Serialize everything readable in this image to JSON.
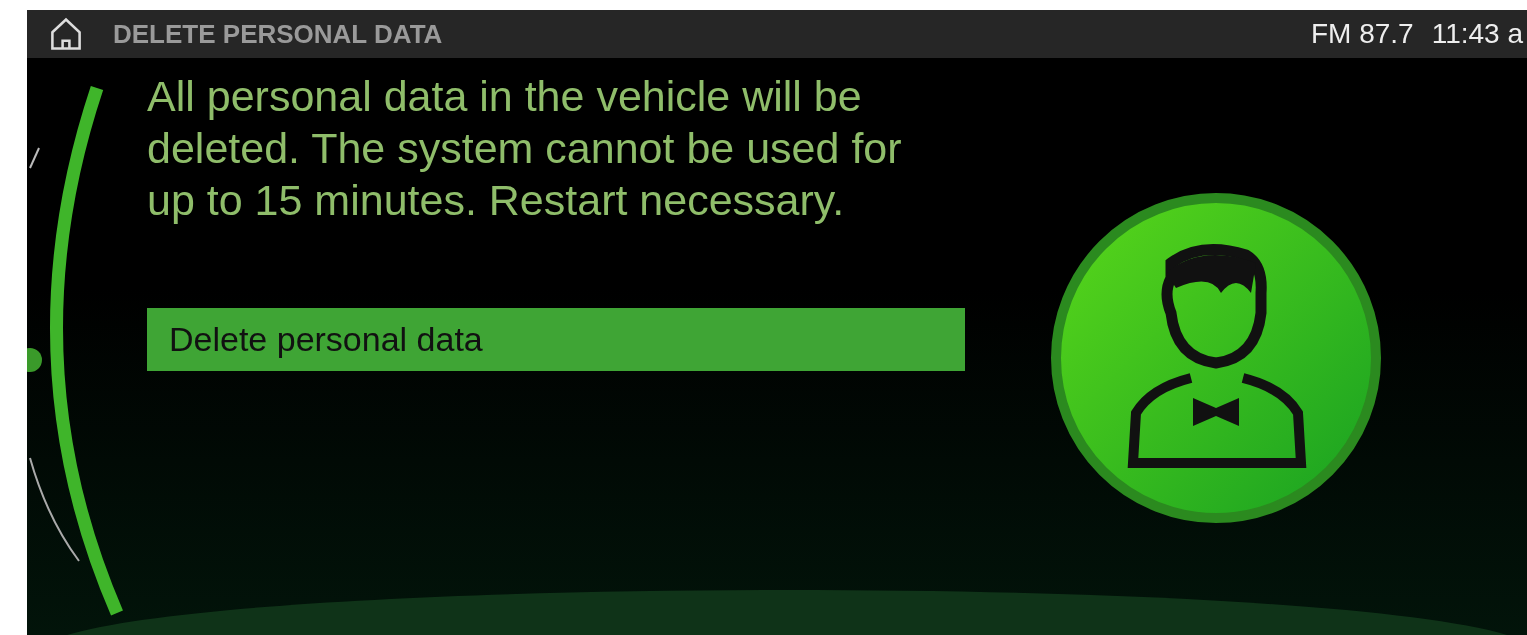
{
  "status_bar": {
    "title": "DELETE PERSONAL DATA",
    "radio": "FM 87.7",
    "clock": "11:43 a"
  },
  "message": "All personal data in the vehicle will be deleted. The system cannot be used for up to 15 minutes. Restart necessary.",
  "menu_items": [
    {
      "label": "Delete personal data",
      "selected": true
    }
  ]
}
